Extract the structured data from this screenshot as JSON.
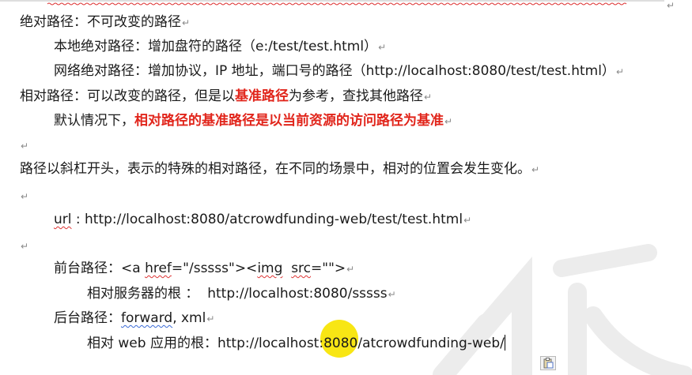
{
  "lines": {
    "l1": "绝对路径：不可改变的路径",
    "l2": "本地绝对路径：增加盘符的路径（e:/test/test.html）",
    "l3": "网络绝对路径：增加协议，IP 地址，端口号的路径（http://localhost:8080/test/test.html）",
    "l4_a": "相对路径：可以改变的路径，但是以",
    "l4_red": "基准路径",
    "l4_b": "为参考，查找其他路径",
    "l5_a": "默认情况下，",
    "l5_red": "相对路径的基准路径是以当前资源的访问路径为基准",
    "l6": "路径以斜杠开头，表示的特殊的相对路径，在不同的场景中，相对的位置会发生变化。",
    "l7_key": "url",
    "l7_rest": " : http://localhost:8080/atcrowdfunding-web/test/test.html",
    "l8_a": "前台路径：<a ",
    "l8_href": "href",
    "l8_b": "=\"/sssss\"><",
    "l8_img": "img",
    "l8_c": "  ",
    "l8_src": "src",
    "l8_d": "=\"\">",
    "l9": "相对服务器的根 ：  http://localhost:8080/sssss",
    "l10_a": "后台路径：",
    "l10_fwd": "forward",
    "l10_b": ", xml",
    "l11": "相对 web 应用的根：http://localhost:8080/atcrowdfunding-web/"
  },
  "para_mark": "↵",
  "colors": {
    "emphasis": "#e1251b",
    "highlight": "#f7e400"
  },
  "icons": {
    "paste": "paste-options-icon"
  }
}
